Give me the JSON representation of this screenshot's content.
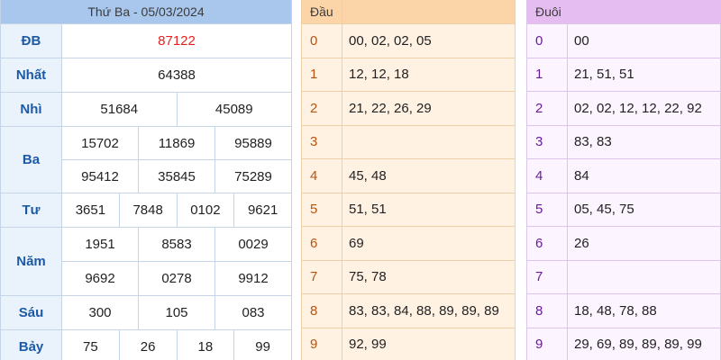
{
  "results": {
    "title": "Thứ Ba - 05/03/2024",
    "rows": [
      {
        "label": "ĐB",
        "values": [
          "87122"
        ]
      },
      {
        "label": "Nhất",
        "values": [
          "64388"
        ]
      },
      {
        "label": "Nhì",
        "values": [
          "51684",
          "45089"
        ]
      },
      {
        "label": "Ba",
        "values": [
          "15702",
          "11869",
          "95889",
          "95412",
          "35845",
          "75289"
        ]
      },
      {
        "label": "Tư",
        "values": [
          "3651",
          "7848",
          "0102",
          "9621"
        ]
      },
      {
        "label": "Năm",
        "values": [
          "1951",
          "8583",
          "0029",
          "9692",
          "0278",
          "9912"
        ]
      },
      {
        "label": "Sáu",
        "values": [
          "300",
          "105",
          "083"
        ]
      },
      {
        "label": "Bảy",
        "values": [
          "75",
          "26",
          "18",
          "99"
        ]
      }
    ]
  },
  "dau": {
    "title": "Đầu",
    "rows": [
      {
        "index": "0",
        "value": "00, 02, 02, 05"
      },
      {
        "index": "1",
        "value": "12, 12, 18"
      },
      {
        "index": "2",
        "value": "21, 22, 26, 29"
      },
      {
        "index": "3",
        "value": ""
      },
      {
        "index": "4",
        "value": "45, 48"
      },
      {
        "index": "5",
        "value": "51, 51"
      },
      {
        "index": "6",
        "value": "69"
      },
      {
        "index": "7",
        "value": "75, 78"
      },
      {
        "index": "8",
        "value": "83, 83, 84, 88, 89, 89, 89"
      },
      {
        "index": "9",
        "value": "92, 99"
      }
    ]
  },
  "duoi": {
    "title": "Đuôi",
    "rows": [
      {
        "index": "0",
        "value": "00"
      },
      {
        "index": "1",
        "value": "21, 51, 51"
      },
      {
        "index": "2",
        "value": "02, 02, 12, 12, 22, 92"
      },
      {
        "index": "3",
        "value": "83, 83"
      },
      {
        "index": "4",
        "value": "84"
      },
      {
        "index": "5",
        "value": "05, 45, 75"
      },
      {
        "index": "6",
        "value": "26"
      },
      {
        "index": "7",
        "value": ""
      },
      {
        "index": "8",
        "value": "18, 48, 78, 88"
      },
      {
        "index": "9",
        "value": "29, 69, 89, 89, 89, 99"
      }
    ]
  },
  "colors": {
    "special_prize": "#e52222",
    "results_header": "#a9c6ec",
    "dau_header": "#fbd4a8",
    "duoi_header": "#e6bdf0"
  }
}
